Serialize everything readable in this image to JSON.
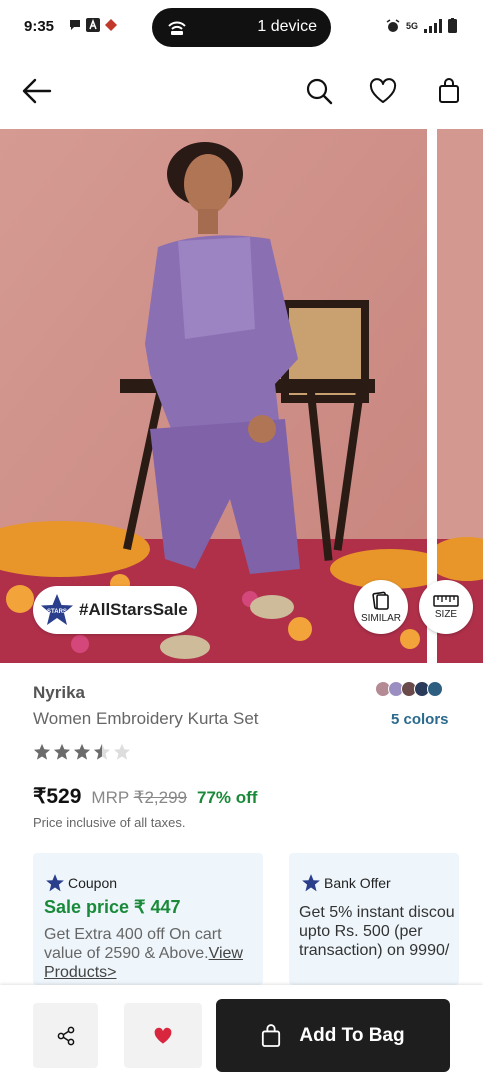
{
  "status_bar": {
    "time": "9:35",
    "device_pill": "1 device",
    "network": "5G"
  },
  "header": {
    "back": "back-arrow-icon",
    "search": "search-icon",
    "wishlist": "heart-icon",
    "bag": "bag-icon"
  },
  "carousel": {
    "badge_text": "#AllStarsSale",
    "badge_logo_text": "STARS",
    "similar_label": "SIMILAR",
    "size_label": "SIZE"
  },
  "product": {
    "brand": "Nyrika",
    "title": "Women Embroidery Kurta Set",
    "colors_label": "5 colors",
    "swatch_colors": [
      "#b48a94",
      "#9b8fc1",
      "#6a4a4a",
      "#2a3a5a",
      "#2e5f80"
    ],
    "rating": 3.5,
    "rating_max": 5,
    "price": "₹529",
    "mrp_label": "MRP",
    "mrp": "₹2,299",
    "discount": "77% off",
    "tax_note": "Price inclusive of all taxes."
  },
  "offers": {
    "coupon": {
      "title": "Coupon",
      "sale_price": "Sale price ₹ 447",
      "desc": "Get Extra 400 off On cart value of 2590 & Above.",
      "link": "View Products>"
    },
    "bank": {
      "title": "Bank Offer",
      "line1": "Get 5% instant discou",
      "line2": "upto Rs. 500 (per",
      "line3": "transaction) on 9990/"
    }
  },
  "bottom_bar": {
    "add_to_bag": "Add To Bag"
  },
  "colors": {
    "accent_green": "#1a8a3a",
    "link_blue": "#2b6a8c",
    "cta_dark": "#1e1e1e",
    "wishlist_red": "#d7263d"
  }
}
